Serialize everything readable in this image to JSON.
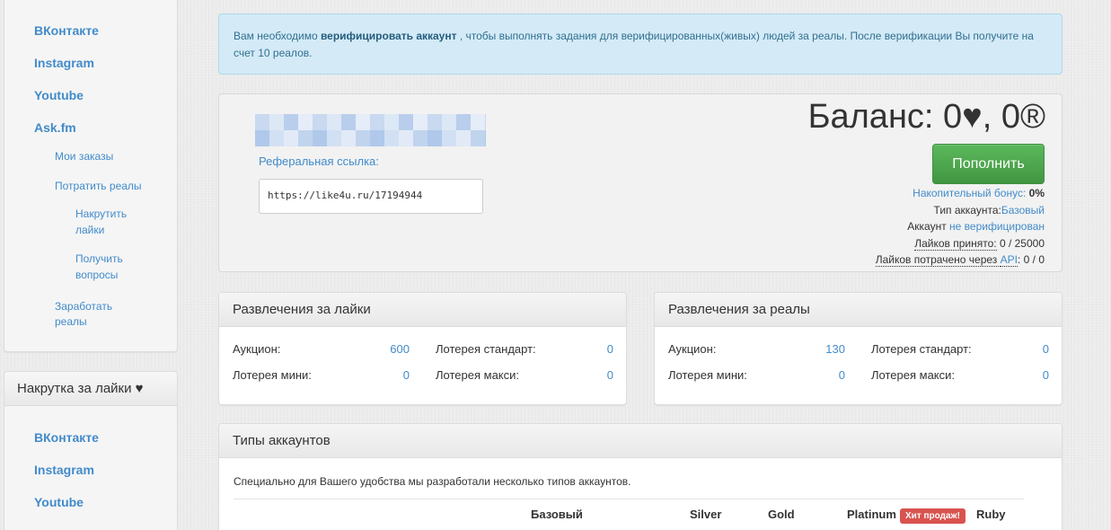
{
  "sidebar": {
    "top_items": [
      "ВКонтакте",
      "Instagram",
      "Youtube",
      "Ask.fm"
    ],
    "sub_items": {
      "my_orders": "Мои заказы",
      "spend_reals": "Потратить реалы",
      "earn_reals": "Заработать реалы"
    },
    "sub_sub_items": {
      "buy_likes": "Накрутить лайки",
      "get_questions": "Получить вопросы"
    },
    "likes_section": {
      "heading": "Накрутка за лайки ♥",
      "items": [
        "ВКонтакте",
        "Instagram",
        "Youtube"
      ]
    }
  },
  "alert": {
    "before": "Вам необходимо ",
    "link": "верифицировать аккаунт",
    "after": " , чтобы выполнять задания для верифицированных(живых) людей за реалы. После верификации Вы получите на счет 10 реалов."
  },
  "profile": {
    "referral_label": "Реферальная ссылка:",
    "referral_url": "https://like4u.ru/17194944"
  },
  "balance": {
    "title": "Баланс: 0♥, 0®",
    "topup_button": "Пополнить",
    "bonus_label": "Накопительный бонус:",
    "bonus_value": "0%",
    "account_type_label": "Тип аккаунта:",
    "account_type_value": "Базовый",
    "account_label": "Аккаунт ",
    "account_status": "не верифицирован",
    "likes_received_label": "Лайков принято:",
    "likes_received_value": "0 / 25000",
    "likes_spent_label": "Лайков потрачено через ",
    "likes_spent_api": "API",
    "likes_spent_value": ": 0 / 0"
  },
  "fun_likes": {
    "heading": "Развлечения за лайки",
    "auction_label": "Аукцион:",
    "auction_value": "600",
    "lottery_std_label": "Лотерея стандарт:",
    "lottery_std_value": "0",
    "lottery_mini_label": "Лотерея мини:",
    "lottery_mini_value": "0",
    "lottery_maxi_label": "Лотерея макси:",
    "lottery_maxi_value": "0"
  },
  "fun_reals": {
    "heading": "Развлечения за реалы",
    "auction_label": "Аукцион:",
    "auction_value": "130",
    "lottery_std_label": "Лотерея стандарт:",
    "lottery_std_value": "0",
    "lottery_mini_label": "Лотерея мини:",
    "lottery_mini_value": "0",
    "lottery_maxi_label": "Лотерея макси:",
    "lottery_maxi_value": "0"
  },
  "account_types": {
    "heading": "Типы аккаунтов",
    "description": "Специально для Вашего удобства мы разработали несколько типов аккаунтов.",
    "columns": [
      "Базовый",
      "Silver",
      "Gold",
      "Platinum",
      "Ruby"
    ],
    "hit_badge": "Хит продаж!"
  },
  "colors": {
    "link": "#428bca",
    "alert_bg": "#d4eaf7",
    "success": "#5cb85c",
    "danger": "#d9534f"
  }
}
